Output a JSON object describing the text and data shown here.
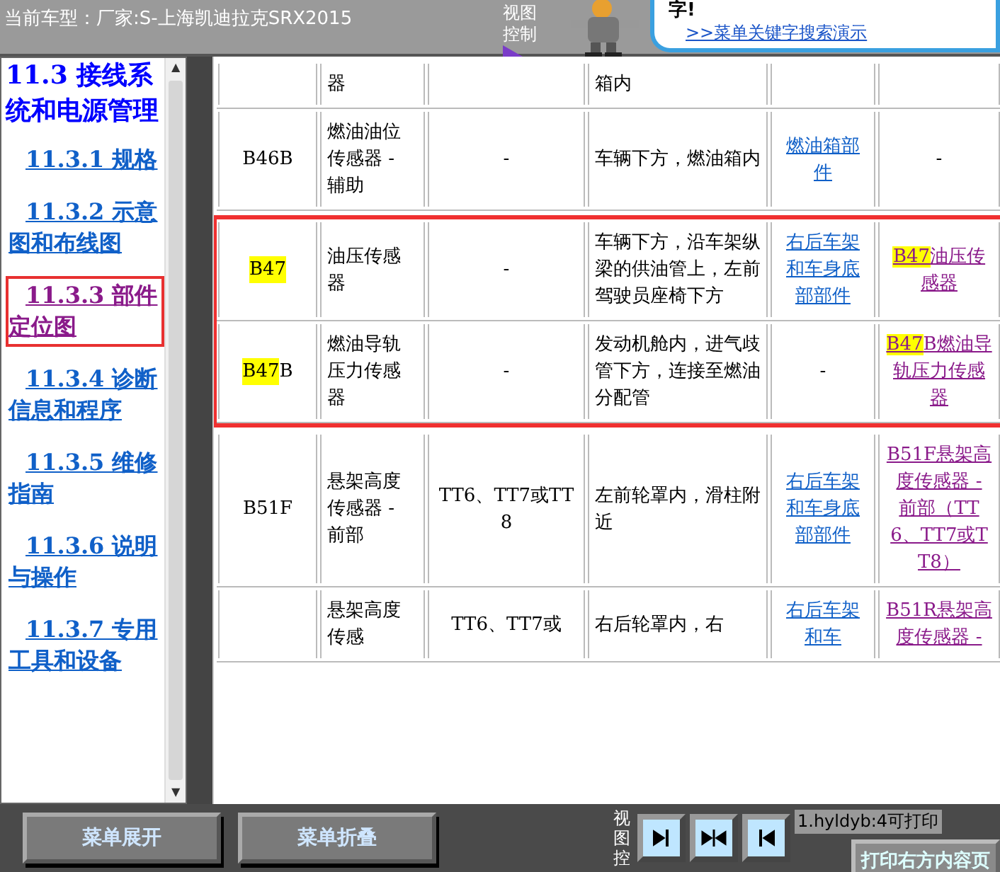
{
  "header": {
    "vehicle": "当前车型：厂家:S-上海凯迪拉克SRX2015",
    "view_control": "视图控制"
  },
  "tip": {
    "text": "字!",
    "link": ">>菜单关键字搜索演示"
  },
  "sidebar": {
    "title": "11.3 接线系统和电源管理",
    "items": [
      {
        "label": "11.3.1 规格",
        "selected": false
      },
      {
        "label": "11.3.2 示意图和布线图",
        "selected": false
      },
      {
        "label": "11.3.3 部件定位图",
        "selected": true
      },
      {
        "label": "11.3.4 诊断信息和程序",
        "selected": false
      },
      {
        "label": "11.3.5 维修指南",
        "selected": false
      },
      {
        "label": "11.3.6 说明与操作",
        "selected": false
      },
      {
        "label": "11.3.7 专用工具和设备",
        "selected": false
      }
    ]
  },
  "table": {
    "row_groups": [
      {
        "framed": false,
        "rows": [
          {
            "column_1": {},
            "column_2": "器",
            "column_4": "箱内",
            "column_5": {
              "kind": "plain"
            },
            "column_6": {
              "kind": "plain"
            }
          },
          {
            "column_1": {
              "text": "B46B"
            },
            "column_2": "燃油油位传感器 - 辅助",
            "column_3": "-",
            "column_4": "车辆下方，燃油箱内",
            "column_5": {
              "kind": "link",
              "text": "燃油箱部件"
            },
            "column_6": {
              "kind": "plain",
              "text": "-"
            }
          }
        ]
      },
      {
        "framed": true,
        "rows": [
          {
            "column_1": {
              "mark": "B47"
            },
            "column_2": "油压传感器",
            "column_3": "-",
            "column_4": "车辆下方，沿车架纵梁的供油管上，左前驾驶员座椅下方",
            "column_5": {
              "kind": "link",
              "text": "右后车架和车身底部部件"
            },
            "column_6": {
              "kind": "link",
              "mark": "B47",
              "text": "油压传感器"
            }
          },
          {
            "column_1": {
              "mark": "B47",
              "text": "B"
            },
            "column_2": "燃油导轨压力传感器",
            "column_3": "-",
            "column_4": "发动机舱内，进气歧管下方，连接至燃油分配管",
            "column_5": {
              "kind": "plain",
              "text": "-"
            },
            "column_6": {
              "kind": "link",
              "mark": "B47",
              "text": "B燃油导轨压力传感器"
            }
          }
        ]
      },
      {
        "framed": false,
        "rows": [
          {
            "column_1": {
              "text": "B51F"
            },
            "column_2": "悬架高度传感器 - 前部",
            "column_3": "TT6、TT7或TT8",
            "column_4": "左前轮罩内，滑柱附近",
            "column_5": {
              "kind": "link",
              "text": "右后车架和车身底部部件"
            },
            "column_6": {
              "kind": "link",
              "text": "B51F悬架高度传感器 - 前部（TT6、TT7或TT8）"
            }
          },
          {
            "column_1": {},
            "column_2": "悬架高度传感",
            "column_3": "TT6、TT7或",
            "column_4": "右后轮罩内，右",
            "column_5": {
              "kind": "link",
              "text": "右后车架和车"
            },
            "column_6": {
              "kind": "link",
              "text": "B51R悬架高度传感器 -"
            }
          }
        ]
      }
    ]
  },
  "scrollbar": {
    "up": "▲",
    "down": "▼"
  },
  "bottom_bar": {
    "buttons": [
      "菜单展开",
      "菜单折叠"
    ],
    "view_label": "视图控",
    "view_buttons": [
      {
        "kind": "right"
      },
      {
        "kind": "both"
      },
      {
        "kind": "left"
      }
    ],
    "status": "1.hyldyb:4可打印",
    "print_button": "打印右方内容页"
  }
}
